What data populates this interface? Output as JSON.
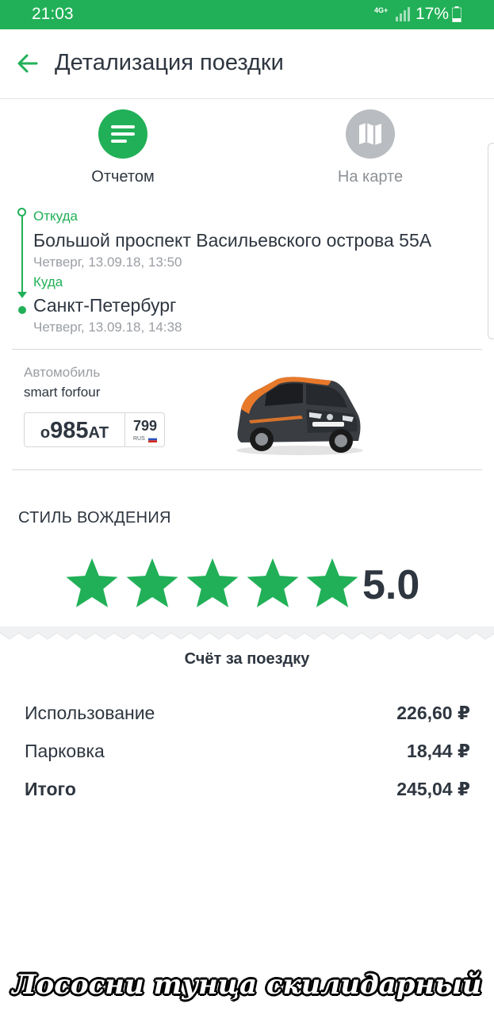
{
  "status_bar": {
    "time": "21:03",
    "network": "4G+",
    "battery": "17%"
  },
  "header": {
    "back_icon": "arrow-left-icon",
    "title": "Детализация поездки"
  },
  "tabs": [
    {
      "label": "Отчетом",
      "icon": "list-icon",
      "active": true,
      "color": "#21b057"
    },
    {
      "label": "На карте",
      "icon": "map-icon",
      "active": false,
      "color": "#b9bcc0"
    }
  ],
  "route": {
    "from_label": "Откуда",
    "from_address": "Большой проспект Васильевского острова 55А",
    "from_time": "Четверг, 13.09.18, 13:50",
    "to_label": "Куда",
    "to_address": "Санкт-Петербург",
    "to_time": "Четверг, 13.09.18, 14:38"
  },
  "car": {
    "caption": "Автомобиль",
    "model": "smart forfour",
    "plate_prefix": "о",
    "plate_digits": "985",
    "plate_suffix": "АТ",
    "plate_region": "799",
    "plate_country": "RUS"
  },
  "driving_style": {
    "title": "СТИЛЬ ВОЖДЕНИЯ",
    "stars_filled": 5,
    "stars_total": 5,
    "rating": "5.0",
    "star_color": "#21b057"
  },
  "bill": {
    "title": "Счёт за поездку",
    "rows": [
      {
        "name": "Использование",
        "amount": "226,60 ₽"
      },
      {
        "name": "Парковка",
        "amount": "18,44 ₽"
      },
      {
        "name": "Итого",
        "amount": "245,04 ₽"
      }
    ]
  },
  "watermark": "Лососни тунца скилидарный",
  "colors": {
    "accent": "#21b057",
    "text": "#2e3640",
    "muted": "#9a9ea3"
  }
}
